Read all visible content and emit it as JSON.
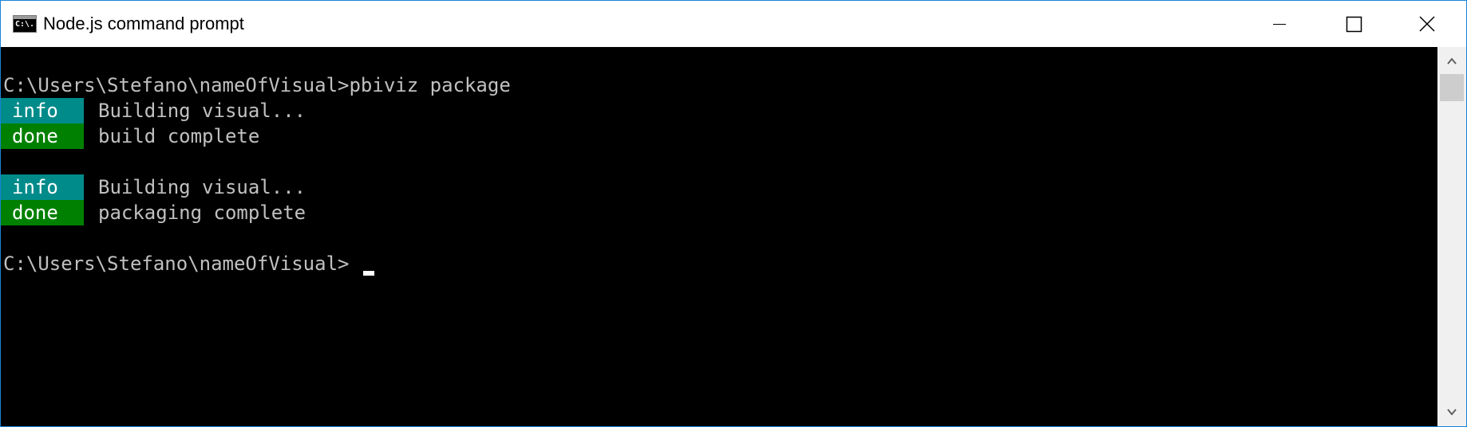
{
  "window": {
    "title": "Node.js command prompt",
    "icon": "console-icon",
    "icon_text": "C:\\.",
    "controls": [
      "minimize-icon",
      "maximize-icon",
      "close-icon"
    ]
  },
  "console": {
    "lines": [
      {
        "kind": "prompt",
        "text": "C:\\Users\\Stefano\\nameOfVisual>pbiviz package"
      },
      {
        "kind": "tagged",
        "tag": "info",
        "tag_color": "#008b8b",
        "text": "Building visual..."
      },
      {
        "kind": "tagged",
        "tag": "done",
        "tag_color": "#008000",
        "text": "build complete"
      },
      {
        "kind": "blank",
        "text": ""
      },
      {
        "kind": "tagged",
        "tag": "info",
        "tag_color": "#008b8b",
        "text": "Building visual..."
      },
      {
        "kind": "tagged",
        "tag": "done",
        "tag_color": "#008000",
        "text": "packaging complete"
      },
      {
        "kind": "blank",
        "text": ""
      },
      {
        "kind": "prompt",
        "text": "C:\\Users\\Stefano\\nameOfVisual>"
      }
    ],
    "text_color": "#c0c0c0",
    "background": "#000000"
  },
  "colors": {
    "info": "#008b8b",
    "done": "#008000",
    "window_border": "#1883d7"
  }
}
